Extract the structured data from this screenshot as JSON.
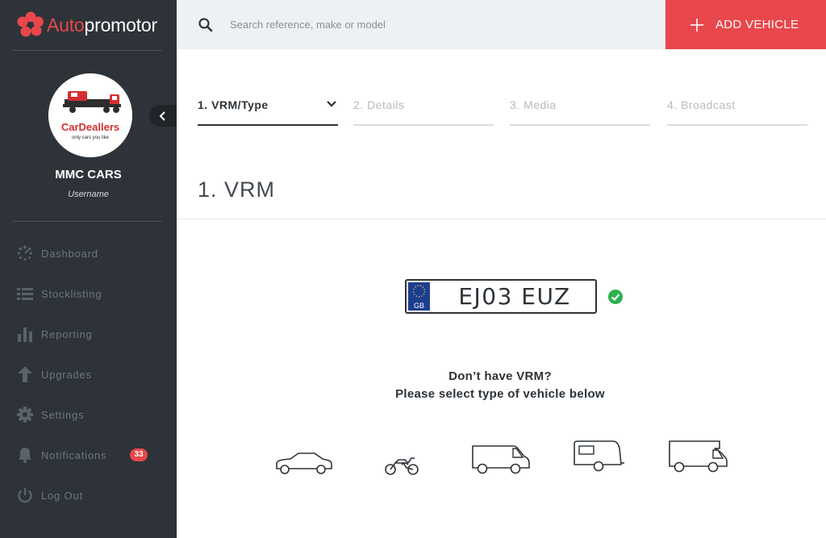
{
  "brand": {
    "name_part1": "Auto",
    "name_part2": "promotor"
  },
  "profile": {
    "dealer_name": "MMC CARS",
    "username": "Username",
    "logo_text": "CarDeallers",
    "logo_tagline": "only cars you like"
  },
  "nav": {
    "items": [
      {
        "label": "Dashboard",
        "icon": "dashboard-icon"
      },
      {
        "label": "Stocklisting",
        "icon": "list-icon"
      },
      {
        "label": "Reporting",
        "icon": "bar-chart-icon"
      },
      {
        "label": "Upgrades",
        "icon": "arrow-up-icon"
      },
      {
        "label": "Settings",
        "icon": "gear-icon"
      },
      {
        "label": "Notifications",
        "icon": "bell-icon",
        "badge": "33"
      },
      {
        "label": "Log Out",
        "icon": "power-icon"
      }
    ]
  },
  "search": {
    "placeholder": "Search reference, make or model"
  },
  "add_vehicle": {
    "label": "ADD VEHICLE"
  },
  "steps": [
    {
      "label": "1. VRM/Type",
      "active": true
    },
    {
      "label": "2. Details",
      "active": false
    },
    {
      "label": "3. Media",
      "active": false
    },
    {
      "label": "4. Broadcast",
      "active": false
    }
  ],
  "section": {
    "title": "1. VRM"
  },
  "plate": {
    "country": "GB",
    "value": "EJ03 EUZ",
    "valid": true
  },
  "prompt": {
    "line1": "Don’t have VRM?",
    "line2": "Please select type of vehicle below"
  },
  "vehicle_types": [
    {
      "icon": "car-icon"
    },
    {
      "icon": "motorbike-icon"
    },
    {
      "icon": "van-icon"
    },
    {
      "icon": "caravan-icon"
    },
    {
      "icon": "motorhome-icon"
    }
  ],
  "colors": {
    "accent": "#e8474b",
    "sidebar": "#2d3338",
    "topbar": "#edf1f4",
    "success": "#2bb24c",
    "plate_eu": "#1d3e8f"
  }
}
